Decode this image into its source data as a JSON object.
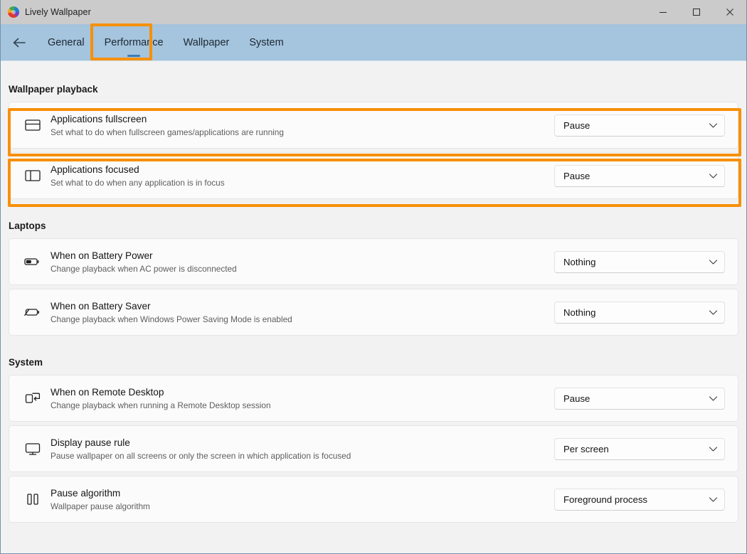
{
  "window": {
    "title": "Lively Wallpaper",
    "app_icon": "lively-logo-icon",
    "controls": {
      "minimize": "minimize-icon",
      "maximize": "maximize-icon",
      "close": "close-icon"
    }
  },
  "navbar": {
    "back": "back-arrow-icon",
    "tabs": [
      {
        "label": "General",
        "selected": false
      },
      {
        "label": "Performance",
        "selected": true
      },
      {
        "label": "Wallpaper",
        "selected": false
      },
      {
        "label": "System",
        "selected": false
      }
    ]
  },
  "highlights": {
    "accent_color": "#F79009",
    "targets": [
      "tab-performance",
      "row-applications-fullscreen",
      "row-applications-focused"
    ]
  },
  "sections": [
    {
      "header": "Wallpaper playback",
      "rows": [
        {
          "icon": "fullscreen-window-icon",
          "title": "Applications fullscreen",
          "subtitle": "Set what to do when fullscreen games/applications are running",
          "value": "Pause"
        },
        {
          "icon": "focused-window-icon",
          "title": "Applications focused",
          "subtitle": "Set what to do when any application is in focus",
          "value": "Pause"
        }
      ]
    },
    {
      "header": "Laptops",
      "rows": [
        {
          "icon": "battery-half-icon",
          "title": "When on Battery Power",
          "subtitle": "Change playback when AC power is disconnected",
          "value": "Nothing"
        },
        {
          "icon": "battery-saver-icon",
          "title": "When on Battery Saver",
          "subtitle": "Change playback when Windows Power Saving Mode is enabled",
          "value": "Nothing"
        }
      ]
    },
    {
      "header": "System",
      "rows": [
        {
          "icon": "remote-desktop-icon",
          "title": "When on Remote Desktop",
          "subtitle": "Change playback when running a Remote Desktop session",
          "value": "Pause"
        },
        {
          "icon": "monitor-icon",
          "title": "Display pause rule",
          "subtitle": "Pause wallpaper on all screens or only the screen in which application is focused",
          "value": "Per screen"
        },
        {
          "icon": "pause-icon",
          "title": "Pause algorithm",
          "subtitle": "Wallpaper pause algorithm",
          "value": "Foreground process"
        }
      ]
    }
  ],
  "colors": {
    "titlebar": "#cbcbcb",
    "navbar": "#a5c4dd",
    "content_bg": "#f2f2f2",
    "card_bg": "#fbfbfb",
    "tab_indicator": "#3b7cb5"
  }
}
